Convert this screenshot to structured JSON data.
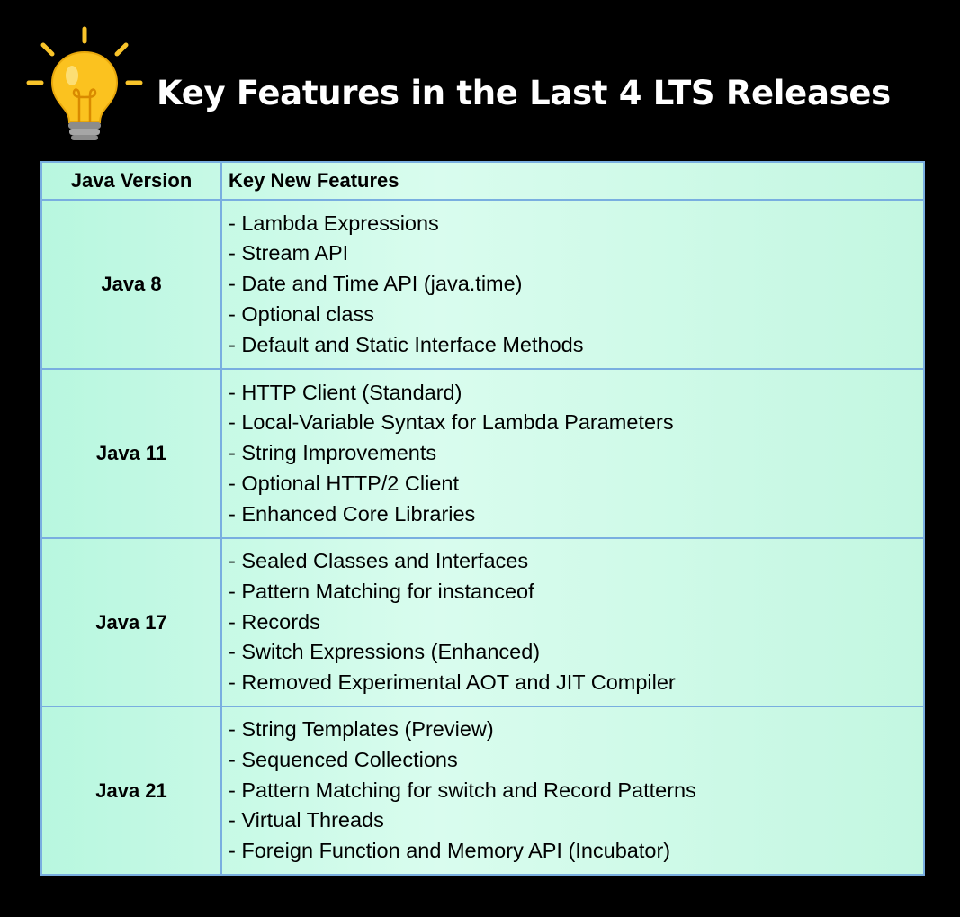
{
  "title": "Key Features in the Last 4 LTS Releases",
  "header_icon": "lightbulb-icon",
  "colors": {
    "background": "#000000",
    "title_text": "#ffffff",
    "table_fill": "#c8f9e5",
    "table_border": "#79aee0",
    "bulb": "#f9c42a"
  },
  "table": {
    "columns": [
      "Java Version",
      "Key New Features"
    ],
    "rows": [
      {
        "version": "Java 8",
        "features": [
          "- Lambda Expressions",
          "- Stream API",
          "- Date and Time API (java.time)",
          "- Optional class",
          "- Default and Static Interface Methods"
        ]
      },
      {
        "version": "Java 11",
        "features": [
          "- HTTP Client (Standard)",
          "- Local-Variable Syntax for Lambda Parameters",
          "- String Improvements",
          "- Optional HTTP/2 Client",
          "- Enhanced Core Libraries"
        ]
      },
      {
        "version": "Java 17",
        "features": [
          "- Sealed Classes and Interfaces",
          "- Pattern Matching for instanceof",
          "- Records",
          "- Switch Expressions (Enhanced)",
          "- Removed Experimental AOT and JIT Compiler"
        ]
      },
      {
        "version": "Java 21",
        "features": [
          "- String Templates (Preview)",
          "- Sequenced Collections",
          "- Pattern Matching for switch and Record Patterns",
          "- Virtual Threads",
          "- Foreign Function and Memory API (Incubator)"
        ]
      }
    ]
  }
}
